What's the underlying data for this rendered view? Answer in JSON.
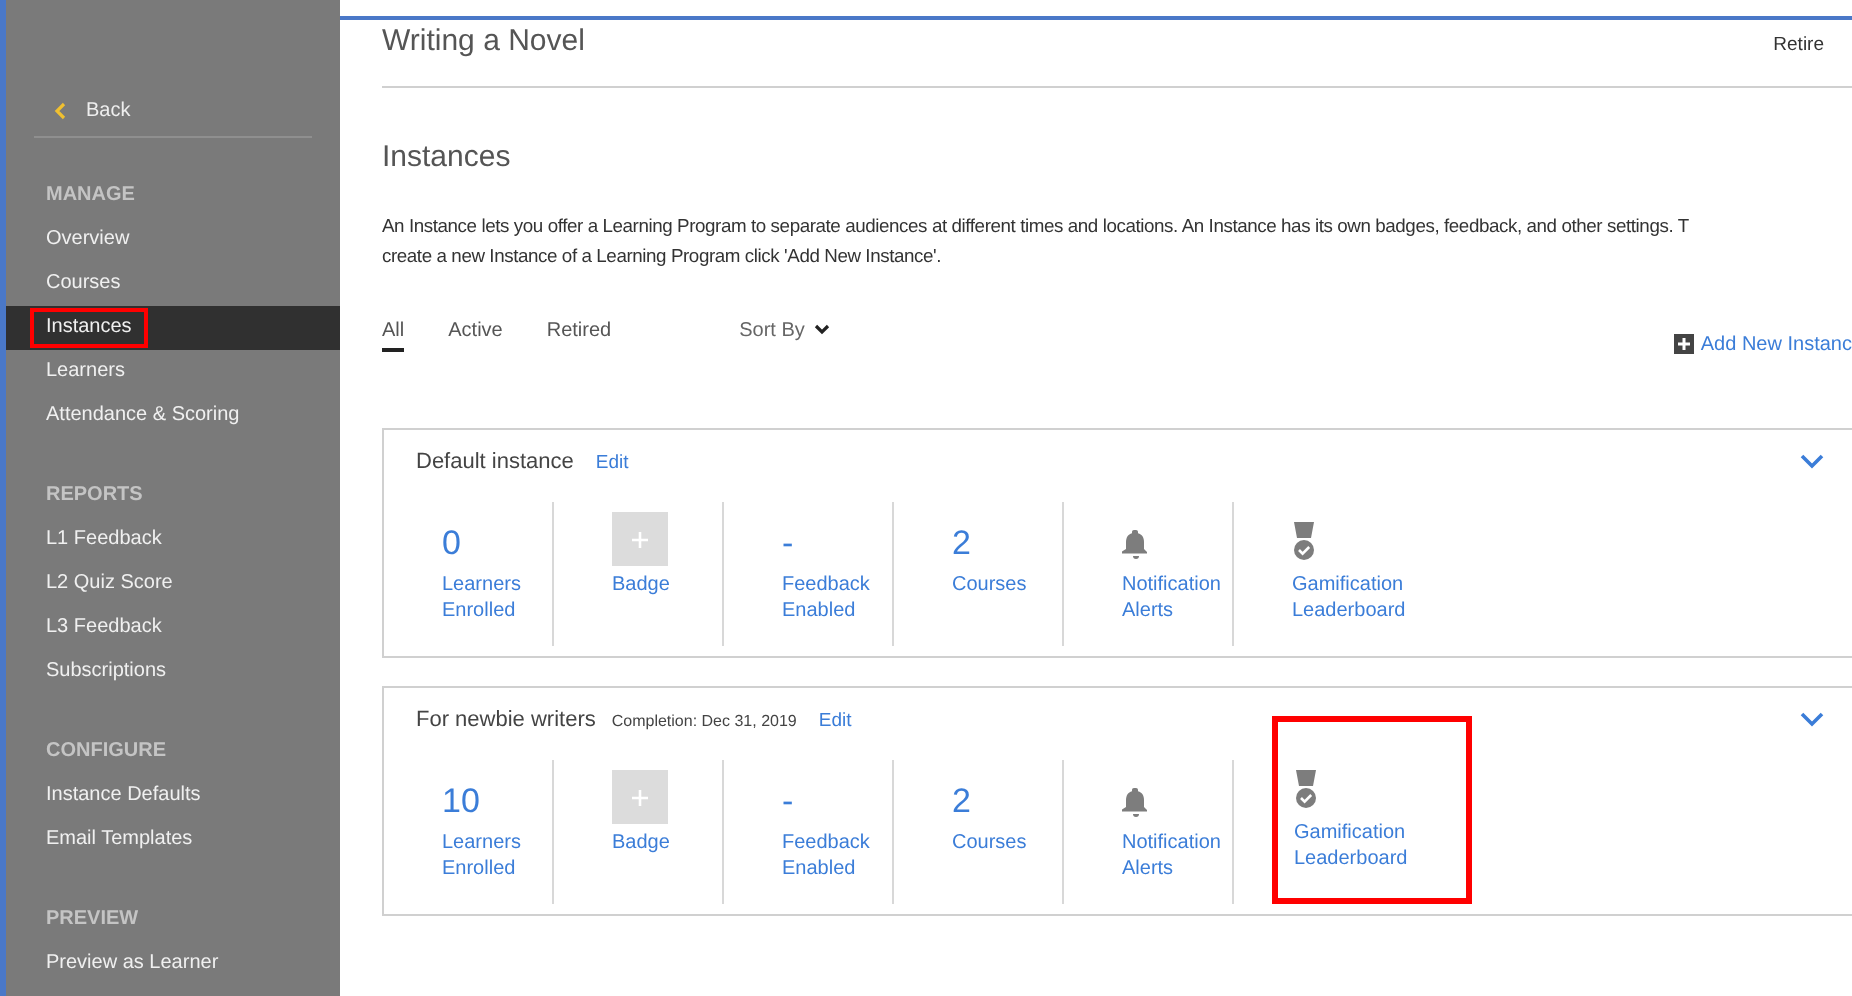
{
  "sidebar": {
    "back": "Back",
    "sections": [
      {
        "heading": "MANAGE",
        "items": [
          {
            "label": "Overview",
            "selected": false,
            "highlighted": false
          },
          {
            "label": "Courses",
            "selected": false,
            "highlighted": false
          },
          {
            "label": "Instances",
            "selected": true,
            "highlighted": true
          },
          {
            "label": "Learners",
            "selected": false,
            "highlighted": false
          },
          {
            "label": "Attendance & Scoring",
            "selected": false,
            "highlighted": false
          }
        ]
      },
      {
        "heading": "REPORTS",
        "items": [
          {
            "label": "L1 Feedback",
            "selected": false,
            "highlighted": false
          },
          {
            "label": "L2 Quiz Score",
            "selected": false,
            "highlighted": false
          },
          {
            "label": "L3 Feedback",
            "selected": false,
            "highlighted": false
          },
          {
            "label": "Subscriptions",
            "selected": false,
            "highlighted": false
          }
        ]
      },
      {
        "heading": "CONFIGURE",
        "items": [
          {
            "label": "Instance Defaults",
            "selected": false,
            "highlighted": false
          },
          {
            "label": "Email Templates",
            "selected": false,
            "highlighted": false
          }
        ]
      },
      {
        "heading": "PREVIEW",
        "items": [
          {
            "label": "Preview as Learner",
            "selected": false,
            "highlighted": false
          }
        ]
      }
    ]
  },
  "header": {
    "title": "Writing a Novel",
    "action": "Retire"
  },
  "section": {
    "title": "Instances",
    "description": [
      "An Instance lets you offer a Learning Program to separate audiences at different times and locations. An Instance has its own badges, feedback, and other settings. T",
      "create a new Instance of a Learning Program click 'Add New Instance'."
    ]
  },
  "tabs": [
    {
      "label": "All",
      "selected": true
    },
    {
      "label": "Active",
      "selected": false
    },
    {
      "label": "Retired",
      "selected": false
    }
  ],
  "sort": "Sort By",
  "add_button": "Add New Instanc",
  "instances": [
    {
      "name": "Default instance",
      "edit": "Edit",
      "tiles": [
        {
          "kind": "count",
          "value": "0",
          "label": "Learners Enrolled",
          "highlighted": false
        },
        {
          "kind": "badge",
          "label": "Badge",
          "highlighted": false
        },
        {
          "kind": "count",
          "value": "-",
          "label": "Feedback Enabled",
          "highlighted": false
        },
        {
          "kind": "count",
          "value": "2",
          "label": "Courses",
          "highlighted": false
        },
        {
          "kind": "bell",
          "label": "Notification Alerts",
          "highlighted": false
        },
        {
          "kind": "medal",
          "label": "Gamification Leaderboard",
          "highlighted": false
        }
      ]
    },
    {
      "name": "For newbie writers",
      "completion": "Completion: Dec 31, 2019",
      "edit": "Edit",
      "tiles": [
        {
          "kind": "count",
          "value": "10",
          "label": "Learners Enrolled",
          "highlighted": false
        },
        {
          "kind": "badge",
          "label": "Badge",
          "highlighted": false
        },
        {
          "kind": "count",
          "value": "-",
          "label": "Feedback Enabled",
          "highlighted": false
        },
        {
          "kind": "count",
          "value": "2",
          "label": "Courses",
          "highlighted": false
        },
        {
          "kind": "bell",
          "label": "Notification Alerts",
          "highlighted": false
        },
        {
          "kind": "medal",
          "label": "Gamification Leaderboard",
          "highlighted": true
        }
      ]
    }
  ]
}
